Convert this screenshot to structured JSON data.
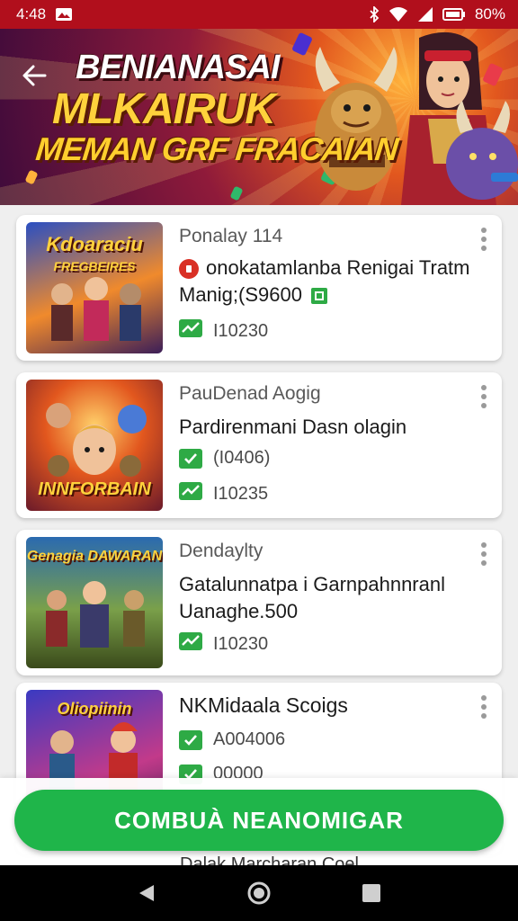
{
  "status_bar": {
    "time": "4:48",
    "battery_percent": "80%"
  },
  "hero": {
    "title_line1": "BENIANASAI",
    "title_line2": "MLKAIRUK",
    "title_line3": "MEMAN GRF FRACAIAN"
  },
  "cards": [
    {
      "thumb_title": "Kdoaraciu",
      "thumb_subtitle": "FREGBEIRES",
      "subtitle": "Ponalay 114",
      "title": "onokatamlanba Renigai Tratm",
      "price_text": "Manig;(S9600",
      "stat_value": "I10230"
    },
    {
      "thumb_title": "INNFORBAIN",
      "subtitle": "PauDenad Aogig",
      "title": "Pardirenmani Dasn olagin",
      "check_value": "(I0406)",
      "stat_value": "I10235"
    },
    {
      "thumb_title": "Genagia DAWARAN",
      "subtitle": "Dendaylty",
      "title": "Gatalunnatpa i Garnpahnnranl",
      "title_line2": "Uanaghe.500",
      "stat_value": "I10230"
    },
    {
      "thumb_title": "Oliopiinin",
      "title": "NKMidaala Scoigs",
      "check_value": "A004006",
      "check_value_2": "00000"
    }
  ],
  "peek_text": "Dalak Marcharan Coel",
  "cta": {
    "label": "COMBUÀ NEANOMIGAR"
  },
  "colors": {
    "status_bar": "#b10f1c",
    "cta": "#1fb54a",
    "check": "#2eaa45",
    "background": "#efefef"
  }
}
